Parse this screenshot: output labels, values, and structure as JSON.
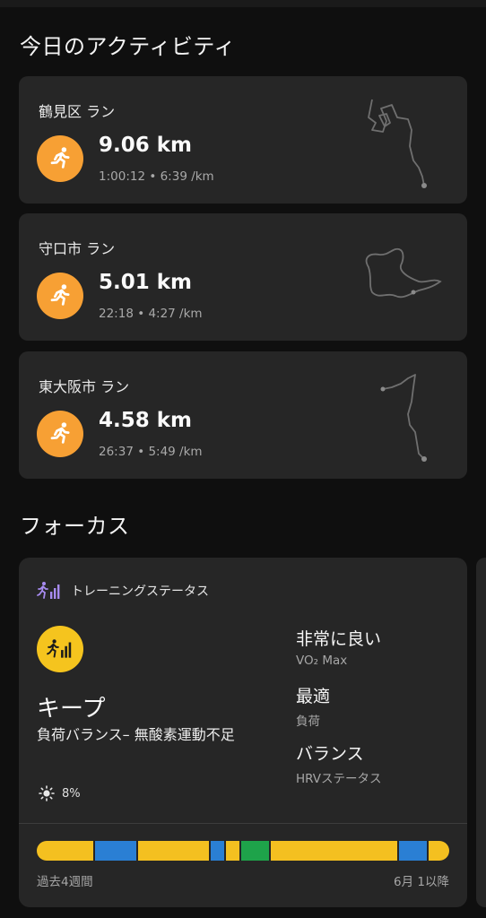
{
  "today_section": {
    "title": "今日のアクティビティ"
  },
  "activities": [
    {
      "title": "鶴見区 ラン",
      "distance": "9.06 km",
      "stats": "1:00:12 • 6:39 /km",
      "icon": "running-icon"
    },
    {
      "title": "守口市 ラン",
      "distance": "5.01 km",
      "stats": "22:18 • 4:27 /km",
      "icon": "running-icon"
    },
    {
      "title": "東大阪市 ラン",
      "distance": "4.58 km",
      "stats": "26:37 • 5:49 /km",
      "icon": "running-icon"
    }
  ],
  "focus_section": {
    "title": "フォーカス"
  },
  "training_status": {
    "header_label": "トレーニングステータス",
    "status": "キープ",
    "description": "負荷バランス– 無酸素運動不足",
    "metrics": [
      {
        "value": "非常に良い",
        "label": "VO₂ Max"
      },
      {
        "value": "最適",
        "label": "負荷"
      },
      {
        "value": "バランス",
        "label": "HRVステータス"
      }
    ],
    "heat_acclimation": "8%",
    "bar_left_label": "過去4週間",
    "bar_right_label": "6月 1以降",
    "timeline": [
      {
        "status": "keep",
        "color": "#f4c020",
        "share": 0.141
      },
      {
        "status": "productive",
        "color": "#2a7fd4",
        "share": 0.104
      },
      {
        "status": "keep",
        "color": "#f4c020",
        "share": 0.176
      },
      {
        "status": "productive",
        "color": "#2a7fd4",
        "share": 0.037
      },
      {
        "status": "keep",
        "color": "#f4c020",
        "share": 0.037
      },
      {
        "status": "peaking",
        "color": "#1ea34a",
        "share": 0.072
      },
      {
        "status": "keep",
        "color": "#f4c020",
        "share": 0.311
      },
      {
        "status": "productive",
        "color": "#2a7fd4",
        "share": 0.072
      },
      {
        "status": "keep",
        "color": "#f4c020",
        "share": 0.05
      }
    ]
  },
  "colors": {
    "accent_orange": "#f7a034",
    "status_yellow": "#f5c41e",
    "card_bg": "#262626",
    "page_bg": "#0f0f0f",
    "header_icon": "#a78bf0"
  }
}
